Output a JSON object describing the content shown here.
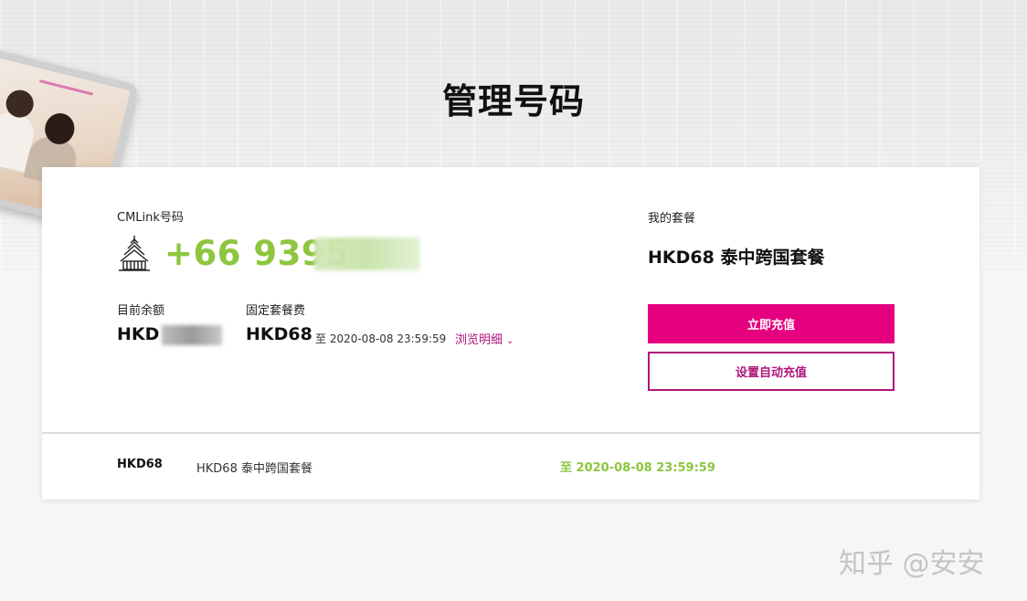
{
  "page": {
    "title": "管理号码"
  },
  "number": {
    "label": "CMLink号码",
    "value": "+66 9395",
    "flag_icon": "thai-temple-icon"
  },
  "balance": {
    "label": "目前余额",
    "value": "HKD"
  },
  "fee": {
    "label": "固定套餐费",
    "value": "HKD68",
    "until": "至 2020-08-08 23:59:59",
    "details_link": "浏览明细"
  },
  "plan": {
    "label": "我的套餐",
    "value": "HKD68 泰中跨国套餐"
  },
  "actions": {
    "recharge": "立即充值",
    "auto_recharge": "设置自动充值"
  },
  "package_row": {
    "code": "HKD68",
    "name": "HKD68 泰中跨国套餐",
    "expiry": "至 2020-08-08 23:59:59"
  },
  "watermark": "知乎 @安安",
  "colors": {
    "accent": "#e4007f",
    "link": "#b0157a",
    "green": "#8dc63f"
  }
}
